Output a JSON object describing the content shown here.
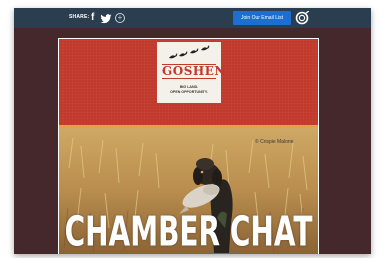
{
  "toolbar": {
    "share_label": "SHARE:",
    "facebook_icon": "f",
    "twitter_icon": "twitter-bird",
    "more_icon": "+",
    "join_button_label": "Join Our Email List",
    "brand_icon": "constant-contact-logo"
  },
  "email": {
    "logo": {
      "name": "GOSHEN",
      "tagline_line1": "BIG LAND.",
      "tagline_line2": "OPEN OPPORTUNITY."
    },
    "photo_credit": "© Crispie Malone",
    "headline": "CHAMBER CHAT"
  },
  "colors": {
    "toolbar_bg": "#2b3e4f",
    "page_bg": "#45282b",
    "banner_red": "#c0392b",
    "accent_stripe": "#e3a23a",
    "join_button": "#1c6fd1"
  }
}
